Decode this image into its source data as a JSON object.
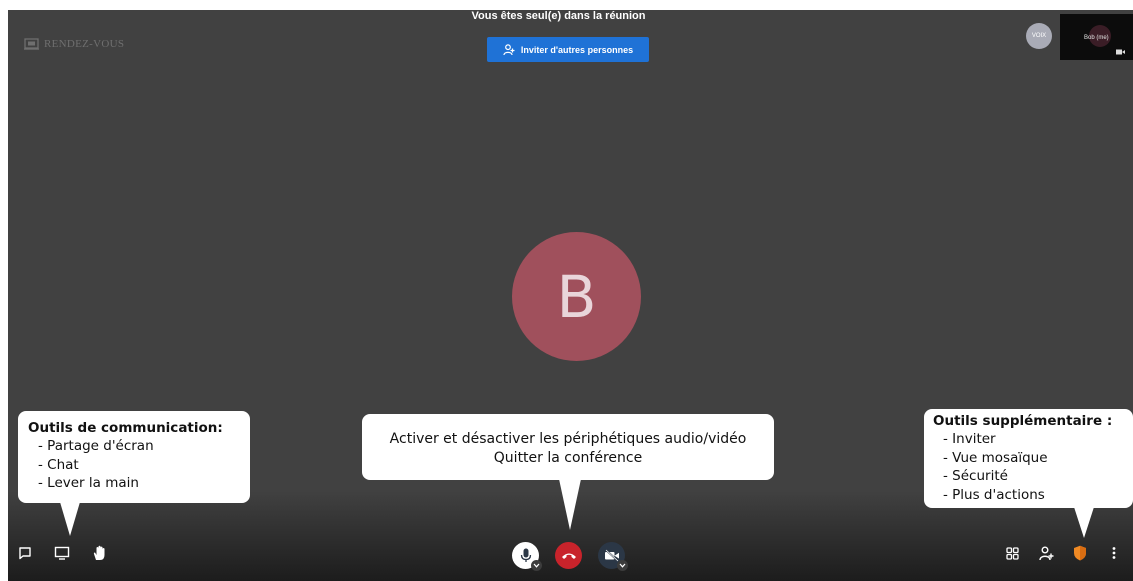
{
  "app": {
    "logo_text": "RENDEZ-VOUS"
  },
  "meeting": {
    "solo_message": "Vous êtes seul(e) dans la réunion",
    "invite_button_label": "Inviter d'autres personnes",
    "participant_avatar_initial": "B",
    "small_avatar_text": "VOIX",
    "self_view_name": "Bob (me)"
  },
  "callouts": {
    "communication": {
      "title": "Outils de communication:",
      "items": [
        "- Partage d'écran",
        "- Chat",
        "- Lever la main"
      ]
    },
    "devices": {
      "line1": "Activer et désactiver les périphétiques audio/vidéo",
      "line2": "Quitter la conférence"
    },
    "extra": {
      "title": "Outils supplémentaire :",
      "items": [
        "- Inviter",
        "- Vue mosaïque",
        "- Sécurité",
        "- Plus d'actions"
      ]
    }
  },
  "toolbar": {
    "left_icons": [
      "chat-icon",
      "screen-share-icon",
      "raise-hand-icon"
    ],
    "center_icons": [
      "microphone-icon",
      "hangup-icon",
      "camera-off-icon"
    ],
    "right_icons": [
      "tile-view-icon",
      "invite-icon",
      "security-shield-icon",
      "more-actions-icon"
    ]
  },
  "colors": {
    "stage_background": "#414141",
    "invite_button": "#1f72d6",
    "avatar": "#a0505c",
    "hangup": "#c8232b",
    "security_shield": "#f08a24"
  }
}
